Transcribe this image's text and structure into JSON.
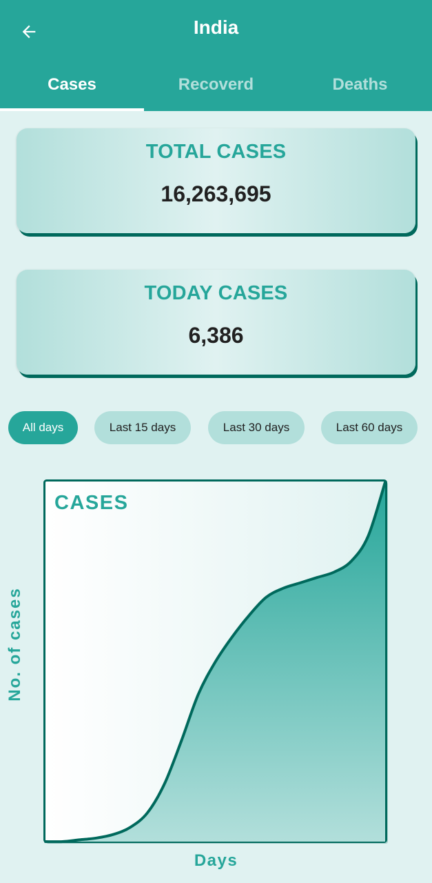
{
  "header": {
    "title": "India"
  },
  "tabs": [
    {
      "label": "Cases",
      "active": true
    },
    {
      "label": "Recoverd",
      "active": false
    },
    {
      "label": "Deaths",
      "active": false
    }
  ],
  "cards": {
    "total": {
      "label": "TOTAL CASES",
      "value": "16,263,695"
    },
    "today": {
      "label": "TODAY CASES",
      "value": "6,386"
    }
  },
  "filters": [
    {
      "label": "All days",
      "active": true
    },
    {
      "label": "Last 15 days",
      "active": false
    },
    {
      "label": "Last 30 days",
      "active": false
    },
    {
      "label": "Last 60 days",
      "active": false
    }
  ],
  "colors": {
    "primary": "#26a69a",
    "dark": "#00695c",
    "background": "#e0f2f1",
    "chip": "#b2dfdb"
  },
  "chart_data": {
    "type": "area",
    "title": "CASES",
    "xlabel": "Days",
    "ylabel": "No. of cases",
    "grid": false,
    "x": [
      0,
      5,
      10,
      15,
      20,
      25,
      30,
      35,
      40,
      45,
      50,
      55,
      60,
      65,
      70,
      75,
      80,
      85,
      90,
      95,
      100
    ],
    "values": [
      0,
      0,
      0.5,
      1,
      2,
      4,
      8,
      16,
      28,
      41,
      50,
      57,
      63,
      68,
      70.5,
      72,
      73.5,
      75,
      78,
      85,
      100
    ],
    "xlim": [
      0,
      100
    ],
    "ylim": [
      0,
      100
    ]
  }
}
